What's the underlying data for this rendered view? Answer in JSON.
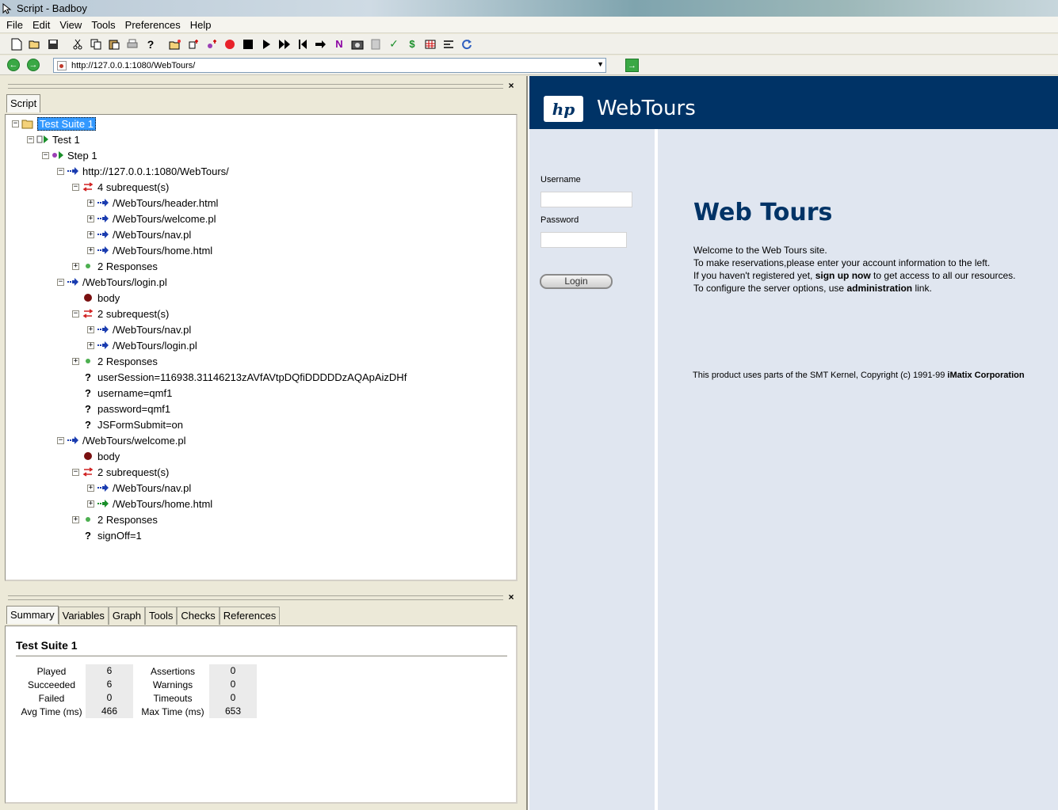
{
  "window": {
    "title": "Script - Badboy"
  },
  "menu": [
    "File",
    "Edit",
    "View",
    "Tools",
    "Preferences",
    "Help"
  ],
  "toolbar_icons": [
    "new-icon",
    "open-icon",
    "save-icon",
    "cut-icon",
    "copy-icon",
    "paste-icon",
    "print-icon",
    "help-icon",
    "add-folder-icon",
    "add-step-icon",
    "add-test-icon",
    "record-icon",
    "stop-icon",
    "play-icon",
    "play-all-icon",
    "rewind-icon",
    "step-over-icon",
    "navigation-icon",
    "screenshot-icon",
    "page-icon",
    "check-icon",
    "variable-icon",
    "table-icon",
    "align-icon",
    "refresh-icon"
  ],
  "address": {
    "url": "http://127.0.0.1:1080/WebTours/"
  },
  "script_tab": "Script",
  "tree": [
    {
      "label": "Test Suite 1",
      "kind": "suite",
      "expanded": true,
      "selected": true
    },
    {
      "label": "Test 1",
      "kind": "test",
      "expanded": true
    },
    {
      "label": "Step 1",
      "kind": "step",
      "expanded": true
    },
    {
      "label": "http://127.0.0.1:1080/WebTours/",
      "kind": "request",
      "expanded": true
    },
    {
      "label": "4 subrequest(s)",
      "kind": "subreq",
      "expanded": true
    },
    {
      "label": "/WebTours/header.html",
      "kind": "request",
      "expanded": false
    },
    {
      "label": "/WebTours/welcome.pl",
      "kind": "request",
      "expanded": false
    },
    {
      "label": "/WebTours/nav.pl",
      "kind": "request",
      "expanded": false
    },
    {
      "label": "/WebTours/home.html",
      "kind": "request",
      "expanded": false
    },
    {
      "label": "2 Responses",
      "kind": "response",
      "expanded": false
    },
    {
      "label": "/WebTours/login.pl",
      "kind": "request",
      "expanded": true
    },
    {
      "label": "body",
      "kind": "body"
    },
    {
      "label": "2 subrequest(s)",
      "kind": "subreq",
      "expanded": true
    },
    {
      "label": "/WebTours/nav.pl",
      "kind": "request",
      "expanded": false
    },
    {
      "label": "/WebTours/login.pl",
      "kind": "request",
      "expanded": false
    },
    {
      "label": "2 Responses",
      "kind": "response",
      "expanded": false
    },
    {
      "label": "userSession=116938.31146213zAVfAVtpDQfiDDDDDzAQApAizDHf",
      "kind": "param"
    },
    {
      "label": "username=qmf1",
      "kind": "param"
    },
    {
      "label": "password=qmf1",
      "kind": "param"
    },
    {
      "label": "JSFormSubmit=on",
      "kind": "param"
    },
    {
      "label": "/WebTours/welcome.pl",
      "kind": "request",
      "expanded": true
    },
    {
      "label": "body",
      "kind": "body"
    },
    {
      "label": "2 subrequest(s)",
      "kind": "subreq",
      "expanded": true
    },
    {
      "label": "/WebTours/nav.pl",
      "kind": "request",
      "expanded": false
    },
    {
      "label": "/WebTours/home.html",
      "kind": "request-green",
      "expanded": false
    },
    {
      "label": "2 Responses",
      "kind": "response",
      "expanded": false
    },
    {
      "label": "signOff=1",
      "kind": "param"
    }
  ],
  "bottom_tabs": [
    "Summary",
    "Variables",
    "Graph",
    "Tools",
    "Checks",
    "References"
  ],
  "summary": {
    "title": "Test Suite 1",
    "left": [
      {
        "label": "Played",
        "value": "6"
      },
      {
        "label": "Succeeded",
        "value": "6"
      },
      {
        "label": "Failed",
        "value": "0"
      },
      {
        "label": "Avg Time (ms)",
        "value": "466"
      }
    ],
    "right": [
      {
        "label": "Assertions",
        "value": "0"
      },
      {
        "label": "Warnings",
        "value": "0"
      },
      {
        "label": "Timeouts",
        "value": "0"
      },
      {
        "label": "Max Time (ms)",
        "value": "653"
      }
    ]
  },
  "webtours": {
    "logo_text": "hp",
    "brand": "WebTours",
    "username_label": "Username",
    "password_label": "Password",
    "login_button": "Login",
    "heading": "Web Tours",
    "line1": "Welcome to the Web Tours site.",
    "line2": "To make reservations,please enter your account information to the left.",
    "line3_pre": "If you haven't registered yet, ",
    "line3_bold": "sign up now",
    "line3_post": " to get access to all our resources.",
    "line4_pre": "To configure the server options, use ",
    "line4_bold": "administration",
    "line4_post": " link.",
    "footer_pre": "This product uses parts of the SMT Kernel, Copyright (c) 1991-99 ",
    "footer_bold": "iMatix Corporation"
  },
  "colors": {
    "header_blue": "#003366",
    "page_bg": "#e0e6f0",
    "selection": "#3399ff",
    "record_red": "#e8222a"
  }
}
